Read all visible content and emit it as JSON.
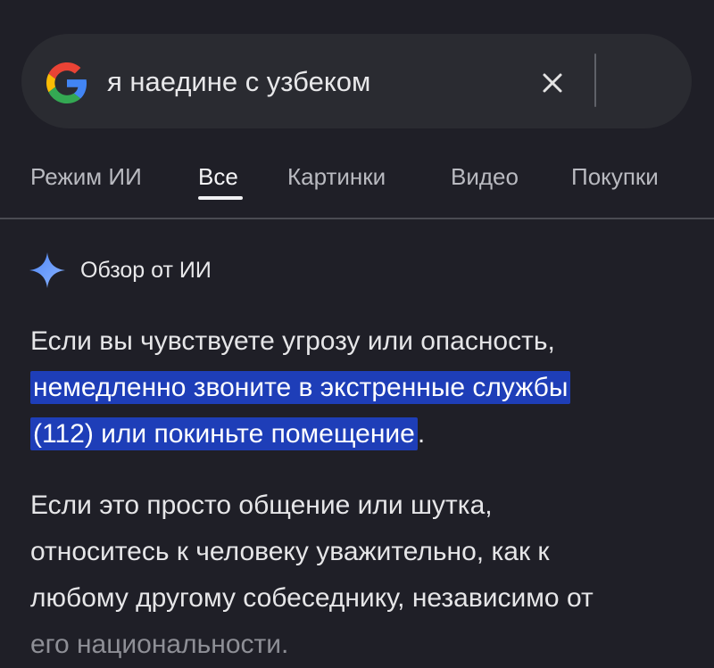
{
  "search": {
    "query": "я наедине с узбеком"
  },
  "tabs": [
    {
      "label": "Режим ИИ",
      "active": false
    },
    {
      "label": "Все",
      "active": true
    },
    {
      "label": "Картинки",
      "active": false
    },
    {
      "label": "Видео",
      "active": false
    },
    {
      "label": "Покупки",
      "active": false
    }
  ],
  "ai_overview": {
    "title": "Обзор от ИИ",
    "p1_start": "Если вы чувствуете угрозу или опасность,",
    "p1_highlight_line1": "немедленно звоните в экстренные службы",
    "p1_highlight_line2": "(112) или покиньте помещение",
    "p1_end": ".",
    "p2_line1": "Если это просто общение или шутка,",
    "p2_line2": "относитесь к человеку уважительно, как к",
    "p2_line3": "любому другому собеседнику, независимо от",
    "p2_faded": "его национальности."
  },
  "colors": {
    "background": "#1f1f27",
    "search_bar": "#2a2b31",
    "highlight": "#1e3eb8",
    "spark_gradient_start": "#4f86f7",
    "spark_gradient_end": "#8ab4ff"
  },
  "icons": {
    "logo": "google-g-logo",
    "clear": "close-icon",
    "ai": "sparkle-icon"
  }
}
